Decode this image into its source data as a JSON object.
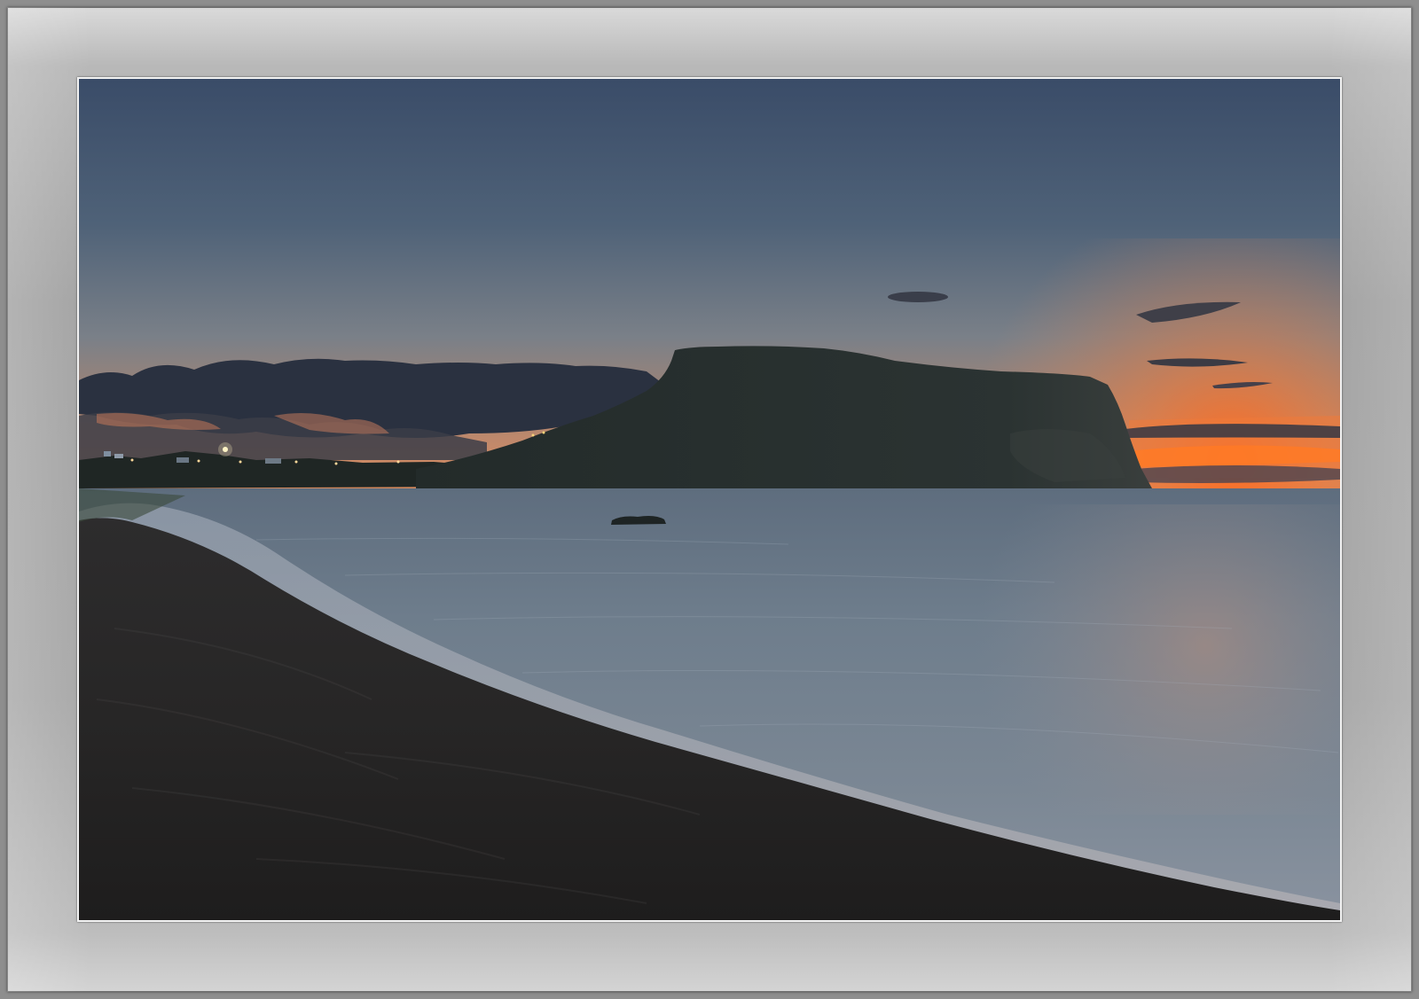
{
  "image": {
    "subject": "",
    "colors": {
      "frame": "#8e8e8e",
      "mat_light": "#dadada",
      "mat_mid": "#a3a3a3",
      "photo_border": "#f2f2f2",
      "sky_top": "#3b4e6a",
      "sky_mid": "#6a7c8c",
      "sky_glow": "#c98a68",
      "horizon_orange": "#ff6a1e",
      "headland": "#252d2c",
      "sea": "#6c7a88",
      "sand": "#2a2929"
    }
  }
}
